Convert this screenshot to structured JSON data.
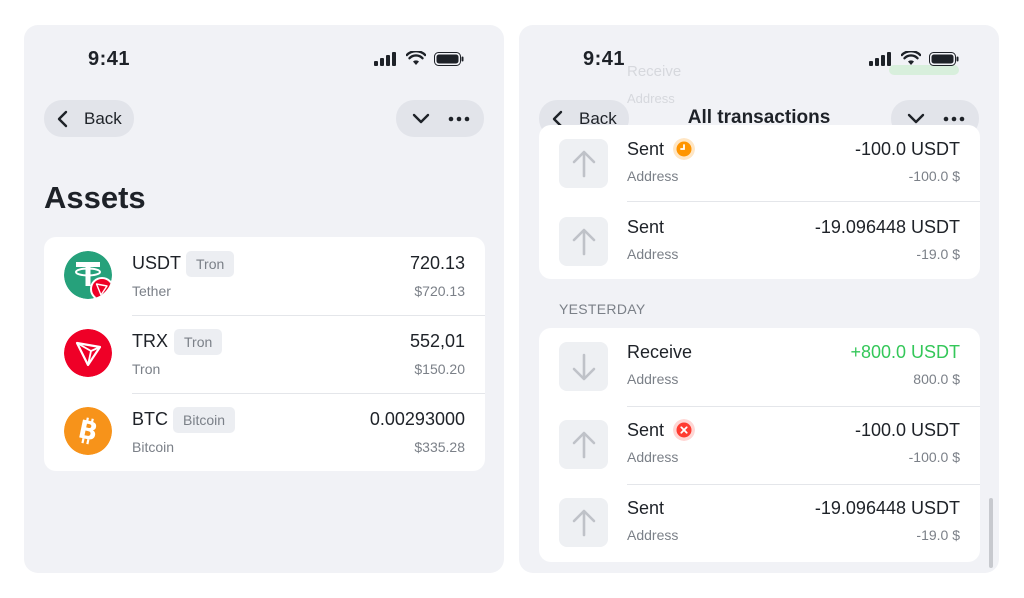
{
  "status_bar": {
    "time": "9:41"
  },
  "nav": {
    "back_label": "Back"
  },
  "assets": {
    "title": "Assets",
    "items": [
      {
        "symbol": "USDT",
        "network": "Tron",
        "name": "Tether",
        "amount": "720.13",
        "fiat": "$720.13",
        "icon": "tether-icon"
      },
      {
        "symbol": "TRX",
        "network": "Tron",
        "name": "Tron",
        "amount": "552,01",
        "fiat": "$150.20",
        "icon": "tron-icon"
      },
      {
        "symbol": "BTC",
        "network": "Bitcoin",
        "name": "Bitcoin",
        "amount": "0.00293000",
        "fiat": "$335.28",
        "icon": "bitcoin-icon"
      }
    ]
  },
  "transactions": {
    "title": "All transactions",
    "ghost_above": {
      "title": "Receive",
      "address": "Address"
    },
    "groups": [
      {
        "label": "",
        "items": [
          {
            "direction": "sent",
            "title": "Sent",
            "address": "Address",
            "amount": "-100.0 USDT",
            "fiat": "-100.0 $",
            "status": "pending"
          },
          {
            "direction": "sent",
            "title": "Sent",
            "address": "Address",
            "amount": "-19.096448 USDT",
            "fiat": "-19.0 $",
            "status": ""
          }
        ]
      },
      {
        "label": "YESTERDAY",
        "items": [
          {
            "direction": "receive",
            "title": "Receive",
            "address": "Address",
            "amount": "+800.0 USDT",
            "fiat": "800.0 $",
            "status": ""
          },
          {
            "direction": "sent",
            "title": "Sent",
            "address": "Address",
            "amount": "-100.0 USDT",
            "fiat": "-100.0 $",
            "status": "failed"
          },
          {
            "direction": "sent",
            "title": "Sent",
            "address": "Address",
            "amount": "-19.096448 USDT",
            "fiat": "-19.0 $",
            "status": ""
          }
        ]
      }
    ]
  },
  "colors": {
    "panel_bg": "#f1f2f6",
    "positive": "#34c759",
    "pending": "#ff9500",
    "failed": "#ff3b30",
    "tether": "#26a17b",
    "tron": "#ef0027",
    "bitcoin": "#f7931a"
  }
}
